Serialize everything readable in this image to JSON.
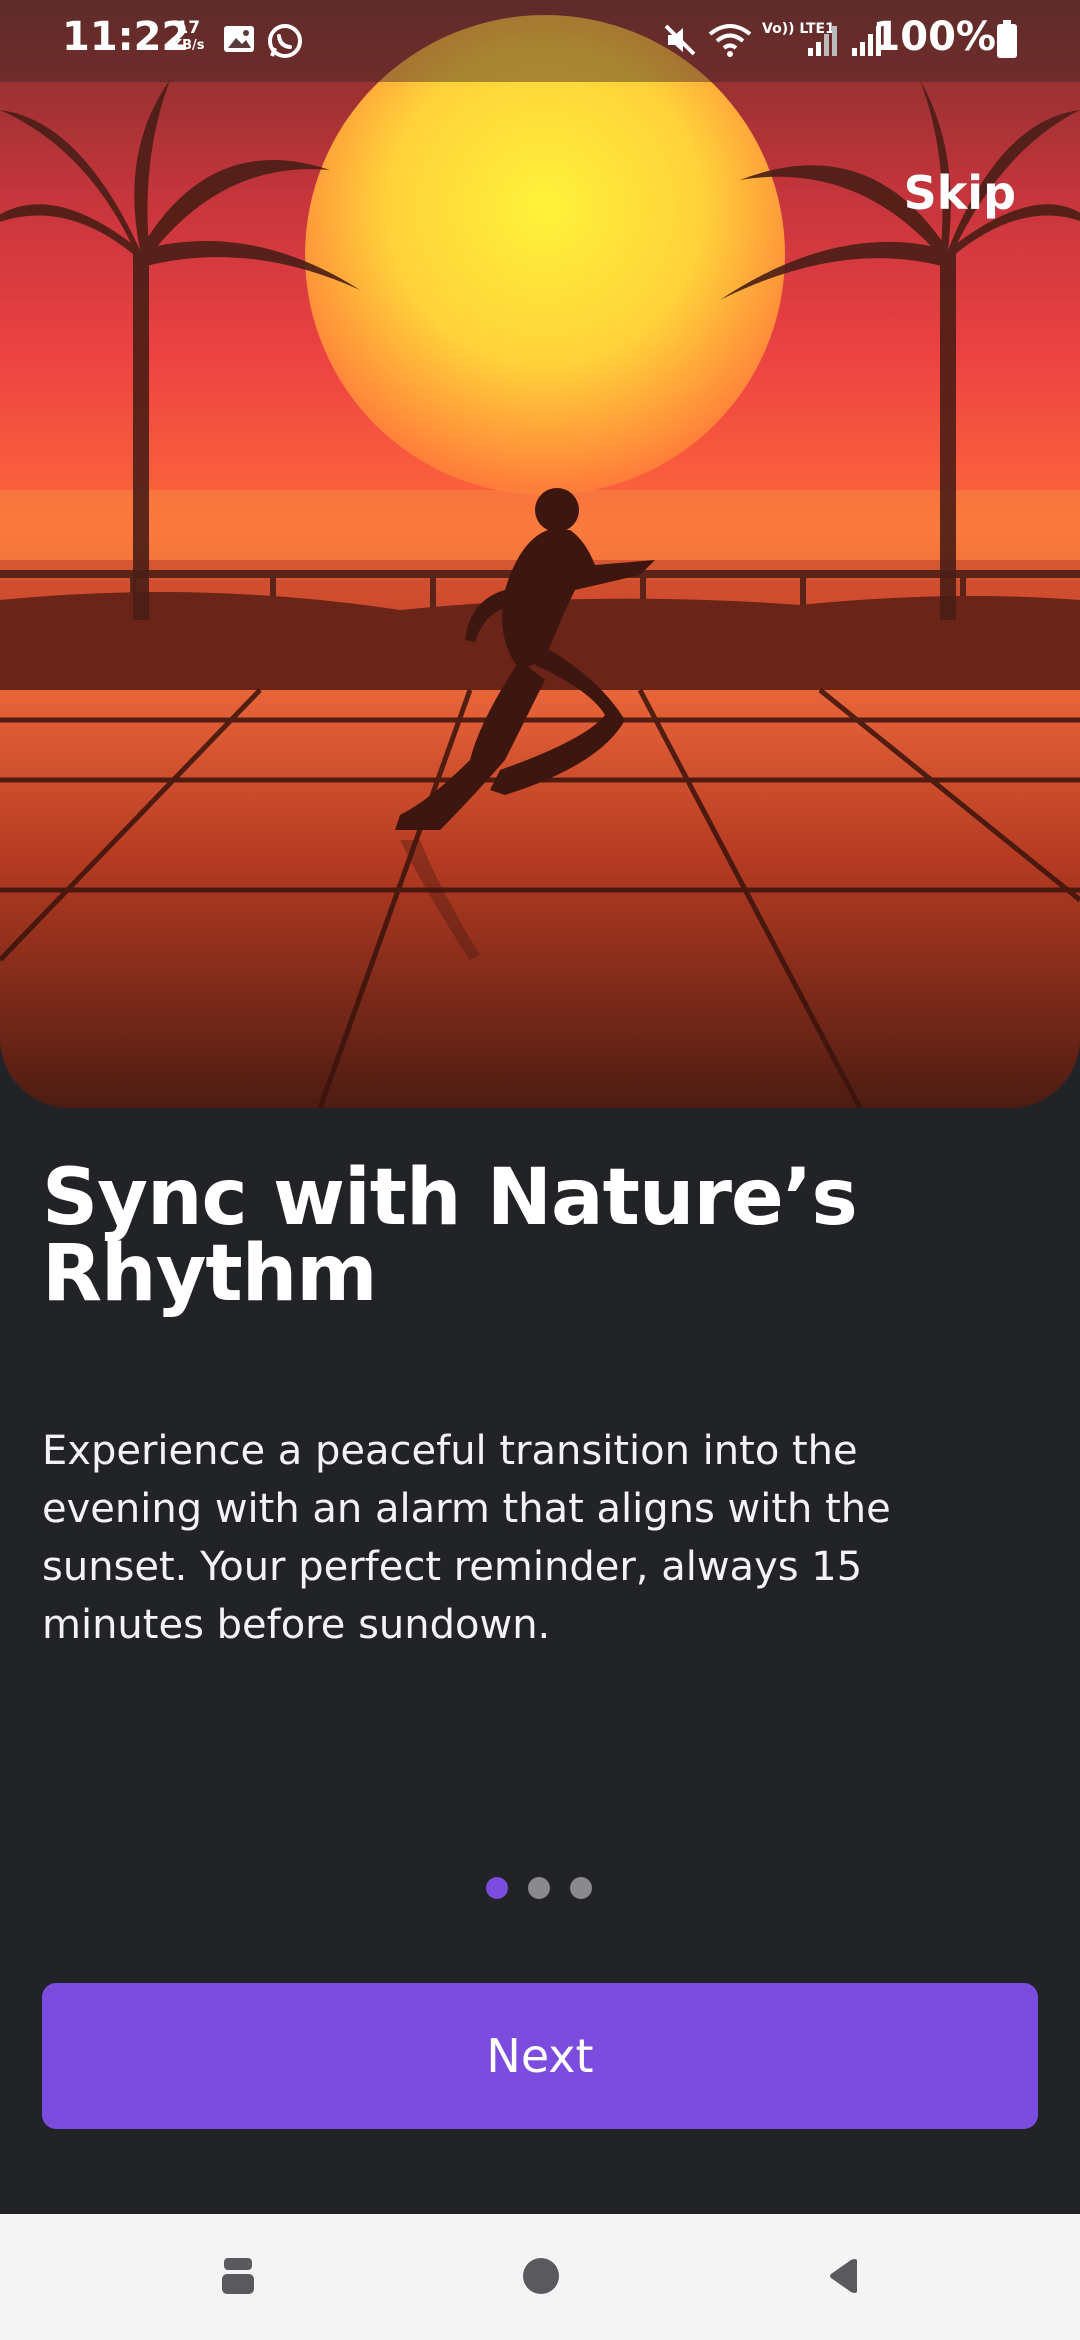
{
  "status_bar": {
    "time": "11:22",
    "speed_value": "17",
    "speed_unit": "KB/s",
    "network_label": "Vo)) LTE1",
    "battery": "100%",
    "icons": [
      "image-icon",
      "whatsapp-icon",
      "mute-icon",
      "wifi-icon",
      "signal-icon",
      "signal-icon",
      "battery-icon"
    ]
  },
  "onboarding": {
    "skip_label": "Skip",
    "title": "Sync with Nature’s Rhythm",
    "description": "Experience a peaceful transition into the evening with an alarm that aligns with the sunset. Your perfect reminder, always 15 minutes before sundown.",
    "page_count": 3,
    "current_page": 1,
    "next_label": "Next"
  },
  "colors": {
    "background": "#222327",
    "accent": "#7b4cde",
    "dot_active": "#7b4cde",
    "dot_inactive": "#8a8a8e"
  },
  "nav_bar": {
    "icons": [
      "recents-icon",
      "home-icon",
      "back-icon"
    ]
  }
}
